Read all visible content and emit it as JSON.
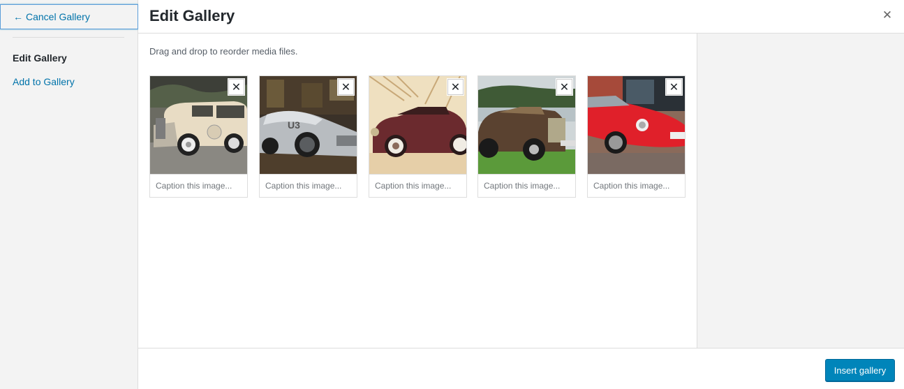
{
  "sidebar": {
    "cancel_arrow": "←",
    "cancel_label": "Cancel Gallery",
    "items": [
      {
        "label": "Edit Gallery"
      },
      {
        "label": "Add to Gallery"
      }
    ]
  },
  "header": {
    "title": "Edit Gallery",
    "close_glyph": "✕"
  },
  "content": {
    "instructions": "Drag and drop to reorder media files.",
    "remove_glyph": "✕",
    "caption_placeholder": "Caption this image...",
    "images": [
      {
        "subject": "cream vintage sedan",
        "caption": ""
      },
      {
        "subject": "silver concept roadster",
        "caption": ""
      },
      {
        "subject": "maroon vintage convertible",
        "caption": ""
      },
      {
        "subject": "brown classic car on lawn",
        "caption": ""
      },
      {
        "subject": "red sports coupe",
        "caption": ""
      }
    ]
  },
  "footer": {
    "insert_label": "Insert gallery"
  },
  "colors": {
    "accent": "#0073aa",
    "primary_button": "#0085ba",
    "sidebar_bg": "#f3f3f3"
  }
}
